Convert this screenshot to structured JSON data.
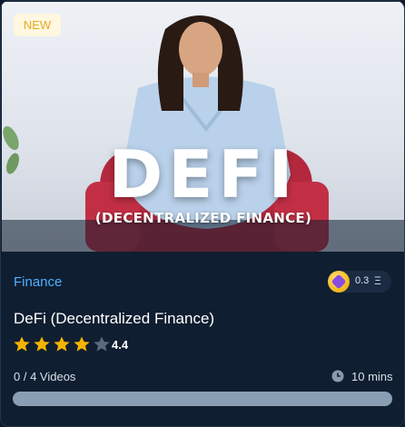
{
  "badge": "NEW",
  "thumbnail": {
    "title": "DEFI",
    "subtitle": "(DECENTRALIZED FINANCE)"
  },
  "category": "Finance",
  "token": {
    "amount": "0.3",
    "symbol": "Ξ",
    "icon": "token-coin-icon"
  },
  "course": {
    "title": "DeFi (Decentralized Finance)"
  },
  "rating": {
    "value": "4.4",
    "stars_filled": 4,
    "stars_total": 5
  },
  "videos": "0 / 4 Videos",
  "duration": "10 mins",
  "progress": {
    "completed": 0,
    "total": 4
  },
  "colors": {
    "accent": "#4db1ff",
    "star_filled": "#f5b301",
    "star_empty": "#5b6b7e",
    "badge_text": "#e5a920",
    "badge_bg": "#fff7df"
  }
}
